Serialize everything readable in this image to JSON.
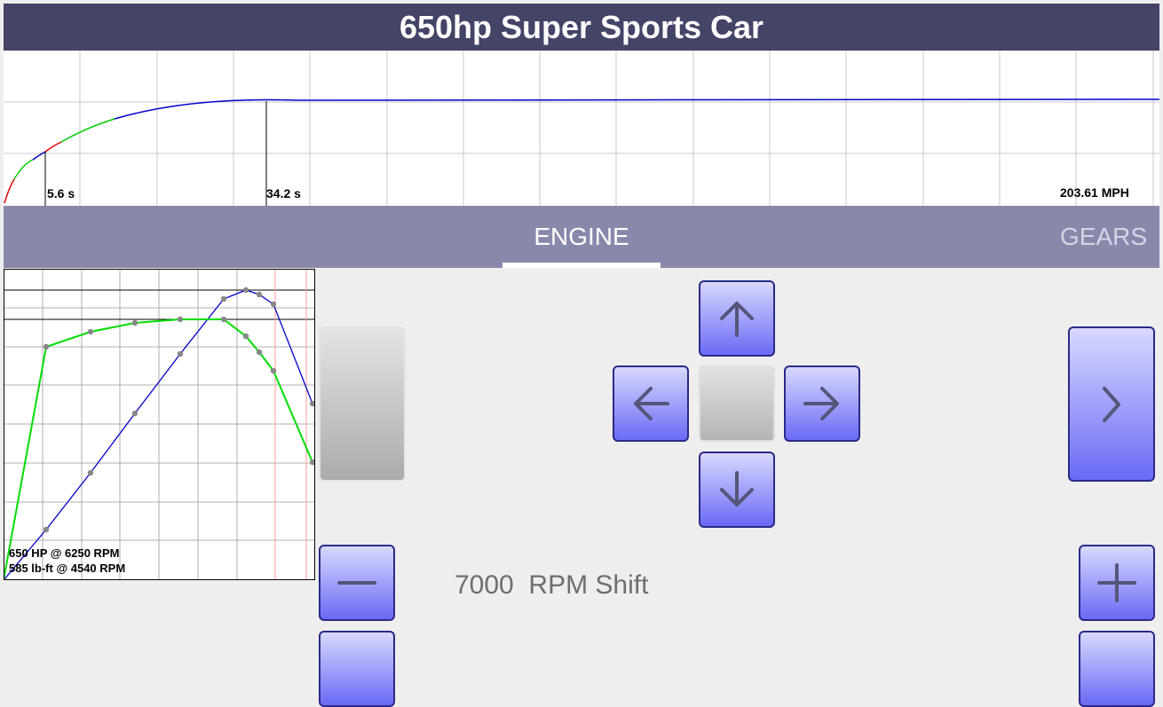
{
  "header": {
    "title": "650hp Super Sports Car"
  },
  "speed_chart": {
    "marker_1_label": "5.6 s",
    "marker_2_label": "34.2 s",
    "top_speed_label": "203.61 MPH",
    "colors": {
      "gear_a": "#e00000",
      "gear_b": "#00cc00",
      "gear_c": "#0000cc",
      "grid": "#c8c8c8"
    }
  },
  "tabs": [
    {
      "label": "ENGINE",
      "selected": true
    },
    {
      "label": "GEARS",
      "selected": false
    }
  ],
  "dyno": {
    "hp_label": "650 HP @ 6250 RPM",
    "torque_label": "585 lb-ft @ 4540 RPM",
    "colors": {
      "power": "#0000cc",
      "torque": "#00dd00",
      "redline": "#ff9999",
      "point": "#888888"
    }
  },
  "controls": {
    "shift_rpm": "7000",
    "shift_unit": "RPM Shift",
    "icons": {
      "up": "arrow-up-icon",
      "down": "arrow-down-icon",
      "left": "arrow-left-icon",
      "right": "arrow-right-icon",
      "next": "chevron-right-icon",
      "minus": "minus-icon",
      "plus": "plus-icon"
    },
    "accent_color": "#6a6af5"
  }
}
